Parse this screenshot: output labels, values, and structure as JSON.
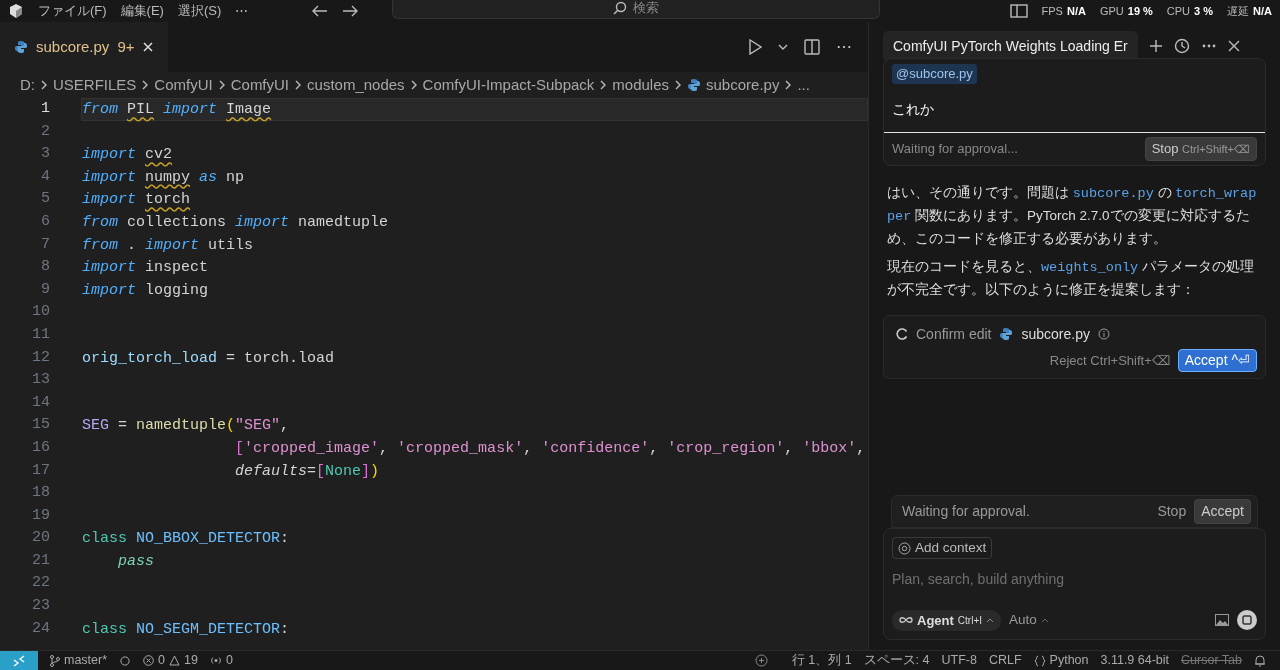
{
  "menu": [
    "ファイル(F)",
    "編集(E)",
    "選択(S)",
    "⋯"
  ],
  "search": {
    "label": "検索"
  },
  "stats": [
    {
      "label": "FPS",
      "value": "N/A"
    },
    {
      "label": "GPU",
      "value": "19 %"
    },
    {
      "label": "CPU",
      "value": "3 %"
    },
    {
      "label": "遅延",
      "value": "N/A"
    }
  ],
  "tabs": [
    {
      "label": "subcore.py",
      "count": "9+",
      "selected": true
    }
  ],
  "editor_actions": [
    "⋯"
  ],
  "breadcrumbs": [
    "D:",
    "USERFILES",
    "ComfyUI",
    "ComfyUI",
    "custom_nodes",
    "ComfyUI-Impact-Subpack",
    "modules",
    "subcore.py",
    "..."
  ],
  "code": [
    {
      "number": "1",
      "current": true,
      "tokens": [
        {
          "text": "from",
          "kind": "kw"
        },
        {
          "text": " PIL",
          "kind": "warn"
        },
        {
          "text": " import",
          "kind": "kw"
        },
        {
          "text": " Image",
          "kind": "warn"
        }
      ]
    },
    {
      "number": "2",
      "current": false
    },
    {
      "number": "3",
      "current": false,
      "tokens": [
        {
          "text": "import",
          "kind": "kw"
        },
        {
          "text": " cv2",
          "kind": "warn"
        }
      ]
    },
    {
      "number": "4",
      "current": false,
      "tokens": [
        {
          "text": "import",
          "kind": "kw"
        },
        {
          "text": " numpy",
          "kind": "warn"
        },
        {
          "text": " as",
          "kind": "kw"
        },
        {
          "text": " np",
          "kind": "p"
        }
      ]
    },
    {
      "number": "5",
      "current": false,
      "tokens": [
        {
          "text": "import",
          "kind": "kw"
        },
        {
          "text": " torch",
          "kind": "warn"
        }
      ]
    },
    {
      "number": "6",
      "current": false,
      "tokens": [
        {
          "text": "from",
          "kind": "kw"
        },
        {
          "text": " collections",
          "kind": "p"
        },
        {
          "text": " import",
          "kind": "kw"
        },
        {
          "text": " namedtuple",
          "kind": "p"
        }
      ]
    },
    {
      "number": "7",
      "current": false,
      "tokens": [
        {
          "text": "from",
          "kind": "kw"
        },
        {
          "text": " .",
          "kind": "p"
        },
        {
          "text": " import",
          "kind": "kw"
        },
        {
          "text": " utils",
          "kind": "p"
        }
      ]
    },
    {
      "number": "8",
      "current": false,
      "tokens": [
        {
          "text": "import",
          "kind": "kw"
        },
        {
          "text": " inspect",
          "kind": "p"
        }
      ]
    },
    {
      "number": "9",
      "current": false,
      "tokens": [
        {
          "text": "import",
          "kind": "kw"
        },
        {
          "text": " logging",
          "kind": "p"
        }
      ]
    },
    {
      "number": "10",
      "current": false
    },
    {
      "number": "11",
      "current": false
    },
    {
      "number": "12",
      "current": false,
      "tokens": [
        {
          "text": "orig_torch_load",
          "kind": "var"
        },
        {
          "text": " = torch.load",
          "kind": "p"
        }
      ]
    },
    {
      "number": "13",
      "current": false
    },
    {
      "number": "14",
      "current": false
    },
    {
      "number": "15",
      "current": false,
      "tokens": [
        {
          "text": "SEG",
          "kind": "const"
        },
        {
          "text": " =",
          "kind": "p"
        },
        {
          "text": " namedtuple",
          "kind": "fn"
        },
        {
          "text": "(",
          "kind": "br1"
        },
        {
          "text": "\"SEG\"",
          "kind": "str"
        },
        {
          "text": ",",
          "kind": "p"
        }
      ]
    },
    {
      "number": "16",
      "current": false,
      "tokens": [
        {
          "text": "                 [",
          "kind": "br2"
        },
        {
          "text": "'cropped_image'",
          "kind": "str"
        },
        {
          "text": ",",
          "kind": "p"
        },
        {
          "text": " 'cropped_mask'",
          "kind": "str"
        },
        {
          "text": ",",
          "kind": "p"
        },
        {
          "text": " 'confidence'",
          "kind": "str"
        },
        {
          "text": ",",
          "kind": "p"
        },
        {
          "text": " 'crop_region'",
          "kind": "str"
        },
        {
          "text": ",",
          "kind": "p"
        },
        {
          "text": " 'bbox'",
          "kind": "str"
        },
        {
          "text": ",",
          "kind": "p"
        }
      ]
    },
    {
      "number": "17",
      "current": false,
      "tokens": [
        {
          "text": "                 defaults",
          "kind": "param"
        },
        {
          "text": "=",
          "kind": "p"
        },
        {
          "text": "[",
          "kind": "br2"
        },
        {
          "text": "None",
          "kind": "none"
        },
        {
          "text": "]",
          "kind": "br2"
        },
        {
          "text": ")",
          "kind": "br1"
        }
      ]
    },
    {
      "number": "18",
      "current": false
    },
    {
      "number": "19",
      "current": false
    },
    {
      "number": "20",
      "current": false,
      "tokens": [
        {
          "text": "class",
          "kind": "cls"
        },
        {
          "text": " NO_BBOX_DETECTOR",
          "kind": "name"
        },
        {
          "text": ":",
          "kind": "p"
        }
      ]
    },
    {
      "number": "21",
      "current": false,
      "tokens": [
        {
          "text": "    pass",
          "kind": "pass"
        }
      ]
    },
    {
      "number": "22",
      "current": false
    },
    {
      "number": "23",
      "current": false
    },
    {
      "number": "24",
      "current": false,
      "tokens": [
        {
          "text": "class",
          "kind": "cls"
        },
        {
          "text": " NO_SEGM_DETECTOR",
          "kind": "name"
        },
        {
          "text": ":",
          "kind": "p"
        }
      ]
    }
  ],
  "chat": {
    "title": "ComfyUI PyTorch Weights Loading Er",
    "user_message": {
      "mention": "@subcore.py",
      "text": "これか",
      "status": "Waiting for approval...",
      "stop": "Stop",
      "stop_shortcut": "Ctrl+Shift+⌫"
    },
    "paragraphs": [
      [
        {
          "kind": "text",
          "text": "はい、その通りです。問題は "
        },
        {
          "kind": "code",
          "text": "subcore.py"
        },
        {
          "kind": "text",
          "text": " の "
        },
        {
          "kind": "code",
          "text": "torch_wrapper"
        },
        {
          "kind": "text",
          "text": " 関数にあります。PyTorch 2.7.0での変更に対応するため、このコードを修正する必要があります。"
        }
      ],
      [
        {
          "kind": "text",
          "text": "現在のコードを見ると、"
        },
        {
          "kind": "code",
          "text": "weights_only"
        },
        {
          "kind": "text",
          "text": " パラメータの処理が不完全です。以下のように修正を提案します："
        }
      ]
    ],
    "edit_card": {
      "label": "Confirm edit",
      "file": "subcore.py",
      "reject": "Reject Ctrl+Shift+⌫",
      "accept": "Accept ^⏎"
    },
    "approval": {
      "text": "Waiting for approval.",
      "stop": "Stop",
      "accept": "Accept"
    },
    "composer": {
      "context": "Add context",
      "placeholder": "Plan, search, build anything",
      "mode": "Agent",
      "mode_shortcut": "Ctrl+I",
      "model": "Auto"
    }
  },
  "status_bar": {
    "branch": "master*",
    "errors": "0",
    "warnings": "19",
    "ports": "0",
    "right": [
      {
        "kind": "text",
        "text": "行 1、列 1"
      },
      {
        "kind": "text",
        "text": "スペース: 4"
      },
      {
        "kind": "text",
        "text": "UTF-8"
      },
      {
        "kind": "text",
        "text": "CRLF"
      },
      {
        "kind": "lang",
        "text": "Python"
      },
      {
        "kind": "text",
        "text": "3.11.9 64-bit"
      },
      {
        "kind": "struck",
        "text": "Cursor Tab"
      }
    ]
  }
}
